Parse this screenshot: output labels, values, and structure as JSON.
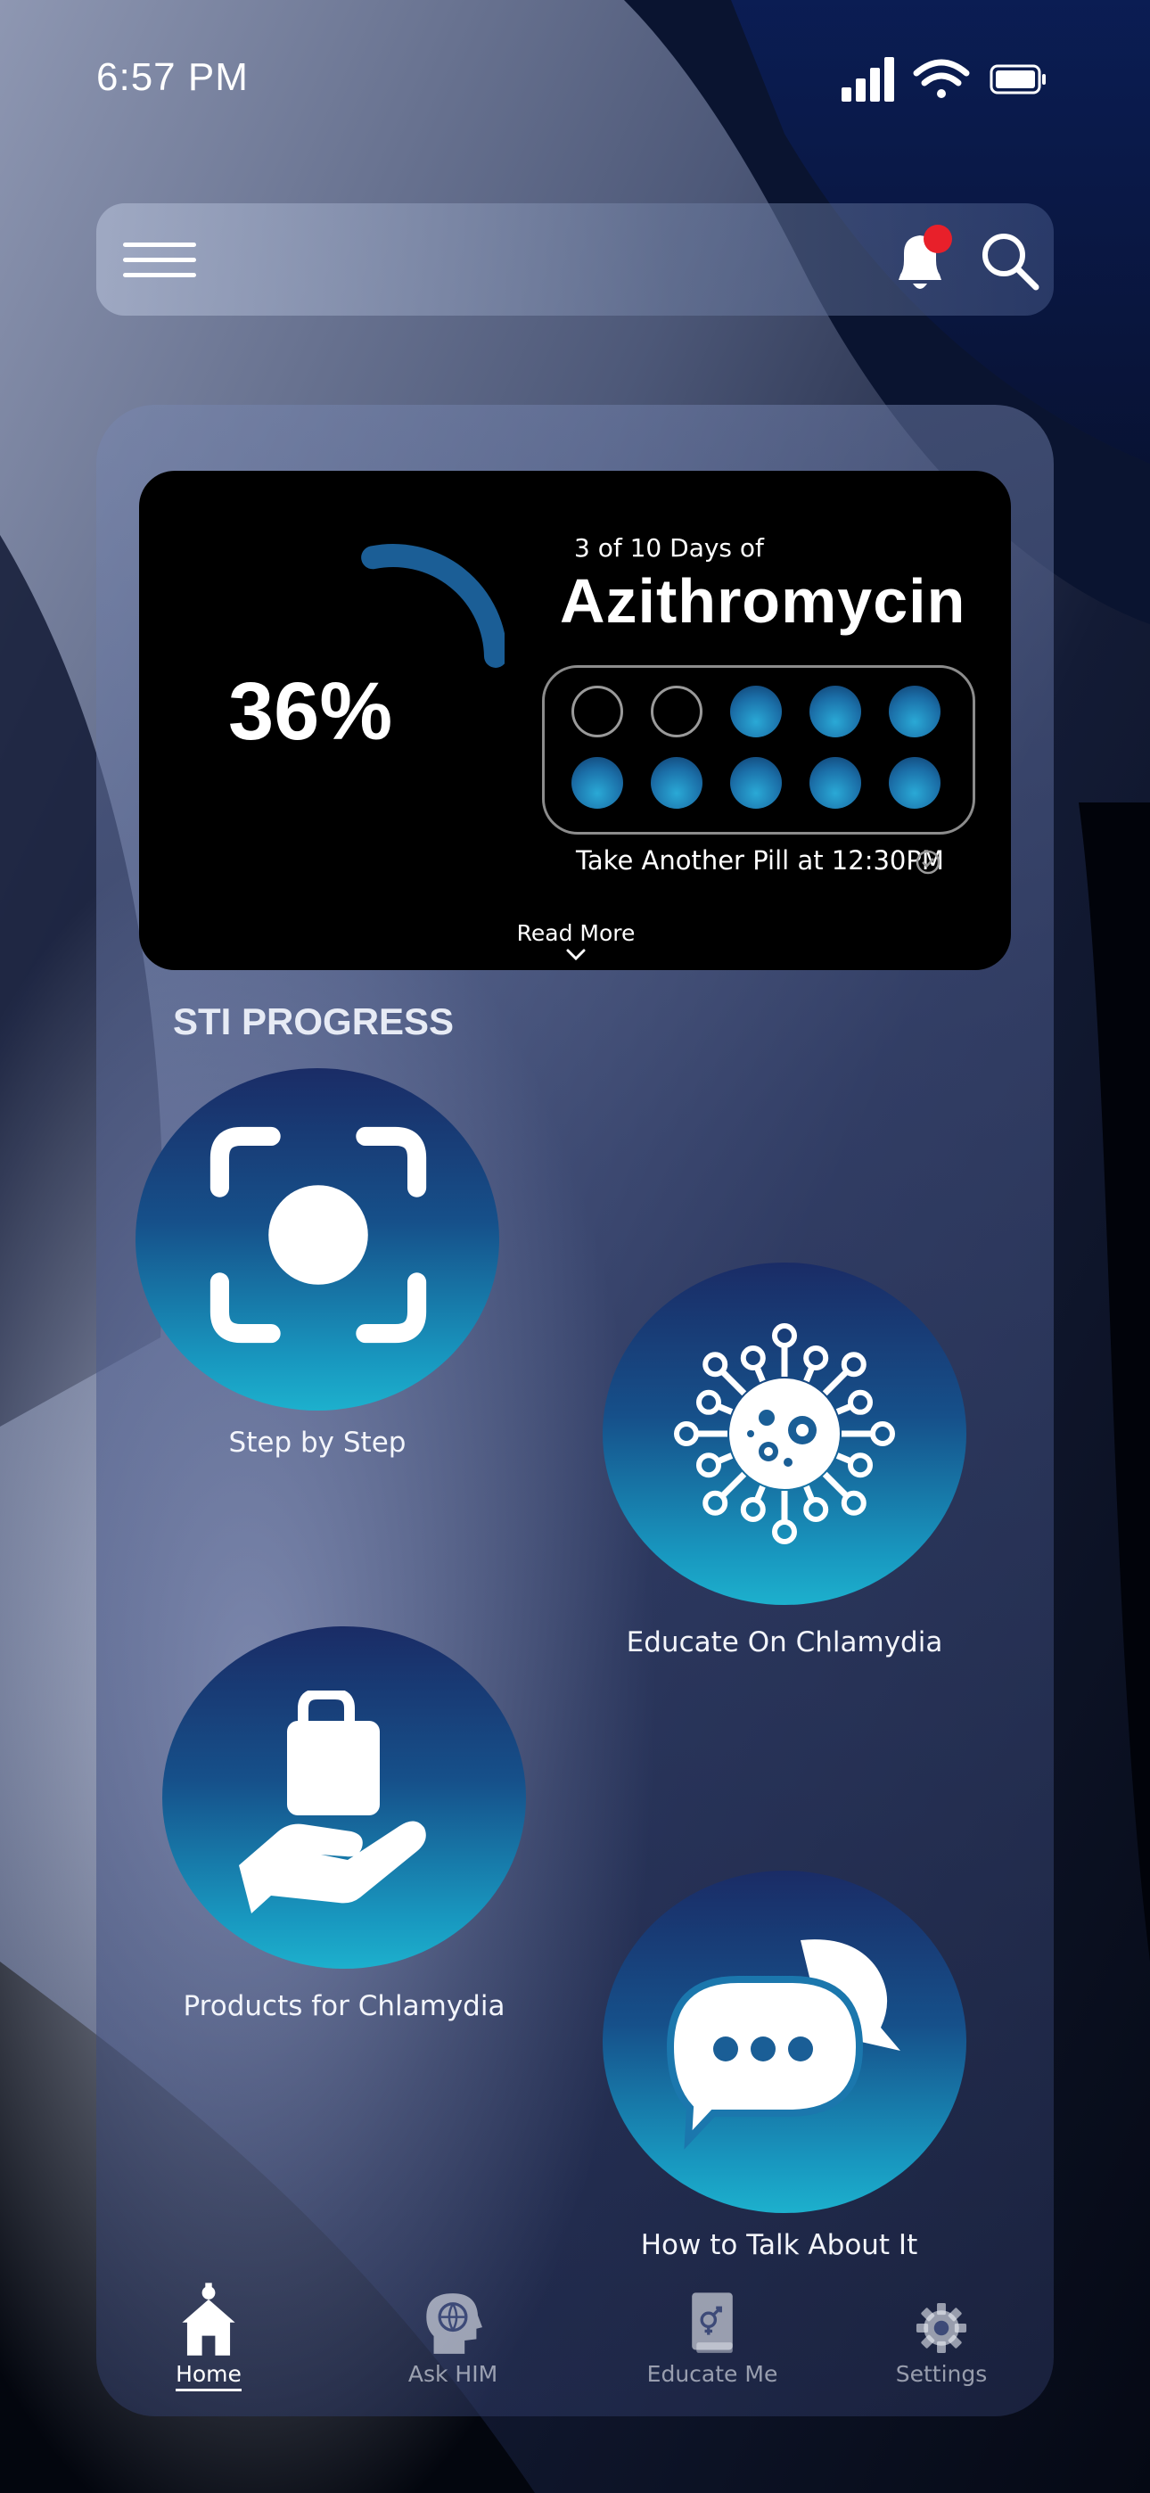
{
  "status_bar": {
    "time": "6:57 PM"
  },
  "medication": {
    "percent": "36%",
    "progress_fraction": 0.36,
    "days_label": "3 of 10 Days of",
    "drug_name": "Azithromycin",
    "pills_total": 10,
    "pills_taken": 2,
    "next_pill": "Take Another Pill at 12:30PM",
    "read_more": "Read More"
  },
  "section_title": "STI PROGRESS",
  "tiles": [
    {
      "label": "Step by Step",
      "icon": "scan-icon"
    },
    {
      "label": "Educate On Chlamydia",
      "icon": "virus-icon"
    },
    {
      "label": "Products for Chlamydia",
      "icon": "hand-bag-icon"
    },
    {
      "label": "How to Talk About It",
      "icon": "chat-bubbles-icon"
    }
  ],
  "nav": [
    {
      "label": "Home",
      "icon": "home-icon",
      "active": true
    },
    {
      "label": "Ask HIM",
      "icon": "head-globe-icon",
      "active": false
    },
    {
      "label": "Educate Me",
      "icon": "book-icon",
      "active": false
    },
    {
      "label": "Settings",
      "icon": "gear-icon",
      "active": false
    }
  ],
  "colors": {
    "accent": "#1db0cd",
    "notification_dot": "#e8202a",
    "card_bg": "#000000"
  }
}
